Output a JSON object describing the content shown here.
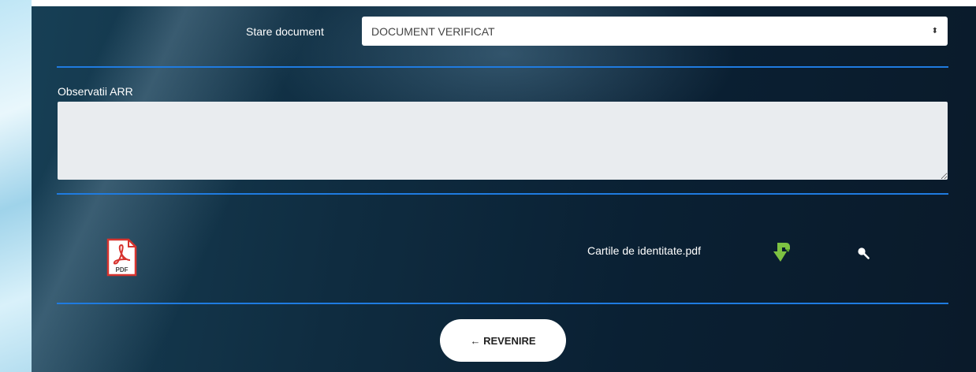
{
  "form": {
    "state_label": "Stare document",
    "state_value": "DOCUMENT VERIFICAT",
    "select_arrow": "⬍",
    "observations_label": "Observatii ARR",
    "observations_value": ""
  },
  "attachment": {
    "icon": "pdf-icon",
    "icon_text": "PDF",
    "file_name": "Cartile de identitate.pdf",
    "actions": [
      "download-icon",
      "search-icon"
    ]
  },
  "footer": {
    "back_label": "← REVENIRE"
  },
  "colors": {
    "accent_rule": "#1f7be0",
    "pdf_red": "#d7342f",
    "download_green": "#7dc242"
  }
}
